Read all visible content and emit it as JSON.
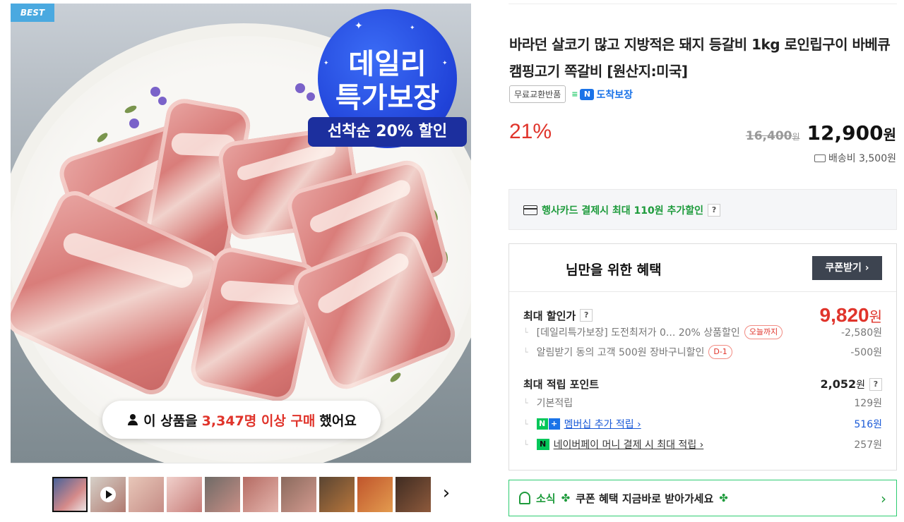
{
  "image": {
    "best_tag": "BEST",
    "promo_line1": "데일리",
    "promo_line2": "특가보장",
    "promo_ribbon": "선착순 20% 할인",
    "buyers": {
      "prefix": "이 상품을",
      "count": "3,347명 이상 구매",
      "suffix": "했어요"
    },
    "thumbnail_count": 10,
    "active_thumbnail": 1
  },
  "product": {
    "title": "바라던 살코기 많고 지방적은 돼지 등갈비 1kg 로인립구이 바베큐 캠핑고기 쪽갈비 [원산지:미국]",
    "badge_return": "무료교환반품",
    "arrival_label": "도착보장",
    "arrival_logo": "N",
    "discount_rate": "21%",
    "original_price": "16,400",
    "sale_price": "12,900",
    "won": "원",
    "shipping": "배송비 3,500원"
  },
  "card_promo": {
    "text": "행사카드 결제시 최대 110원 추가할인",
    "help": "?"
  },
  "benefits": {
    "title": "님만을 위한 혜택",
    "coupon_button": "쿠폰받기 ›",
    "max_discount_label": "최대 할인가",
    "max_discount_help": "?",
    "max_discount_value": "9,820",
    "discount_items": [
      {
        "label": "[데일리특가보장] 도전최저가 0...  20% 상품할인",
        "tag": "오늘까지",
        "value": "-2,580원"
      },
      {
        "label": "알림받기 동의 고객 500원 장바구니할인",
        "tag": "D-1",
        "value": "-500원"
      }
    ],
    "points_label": "최대 적립 포인트",
    "points_value": "2,052",
    "points_help": "?",
    "point_items": [
      {
        "label": "기본적립",
        "value": "129원"
      },
      {
        "label": "멤버십 추가 적립 ›",
        "value": "516원"
      },
      {
        "label": "네이버페이 머니 결제 시 최대 적립 ›",
        "value": "257원"
      }
    ]
  },
  "news": {
    "tag": "소식",
    "text": "쿠폰 혜택 지금바로 받아가세요",
    "arrow": "›"
  },
  "colors": {
    "accent_red": "#e0342b",
    "naver_green": "#03c75a",
    "promo_blue": "#2042d8"
  }
}
